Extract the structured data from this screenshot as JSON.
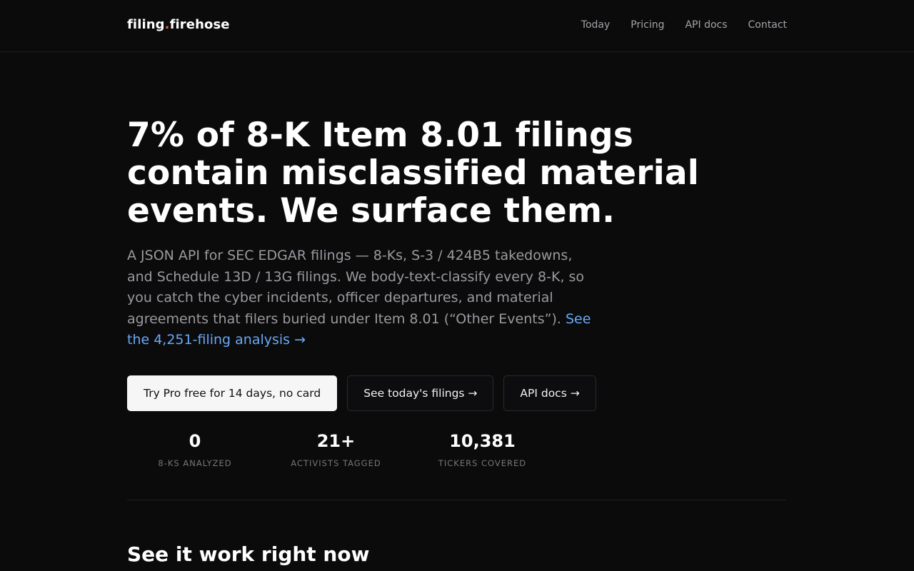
{
  "brand": {
    "part1": "filing",
    "dot": ".",
    "part2": "firehose"
  },
  "nav": {
    "items": [
      "Today",
      "Pricing",
      "API docs",
      "Contact"
    ]
  },
  "hero": {
    "headline_lines": [
      "7% of 8-K Item 8.01 filings",
      "contain misclassified material",
      "events. We surface them."
    ],
    "lead_text": "A JSON API for SEC EDGAR filings — 8-Ks, S-3 / 424B5 takedowns, and Schedule 13D / 13G filings. We body-text-classify every 8-K, so you catch the cyber incidents, officer departures, and material agreements that filers buried under Item 8.01 (“Other Events”). ",
    "lead_link": "See the 4,251-filing analysis →"
  },
  "buttons": {
    "primary": "Try Pro free for 14 days, no card",
    "filings": "See today's filings →",
    "api": "API docs →"
  },
  "stats": [
    {
      "value": "0",
      "label": "8-KS ANALYZED"
    },
    {
      "value": "21+",
      "label": "ACTIVISTS TAGGED"
    },
    {
      "value": "10,381",
      "label": "TICKERS COVERED"
    }
  ],
  "section": {
    "title": "See it work right now"
  }
}
